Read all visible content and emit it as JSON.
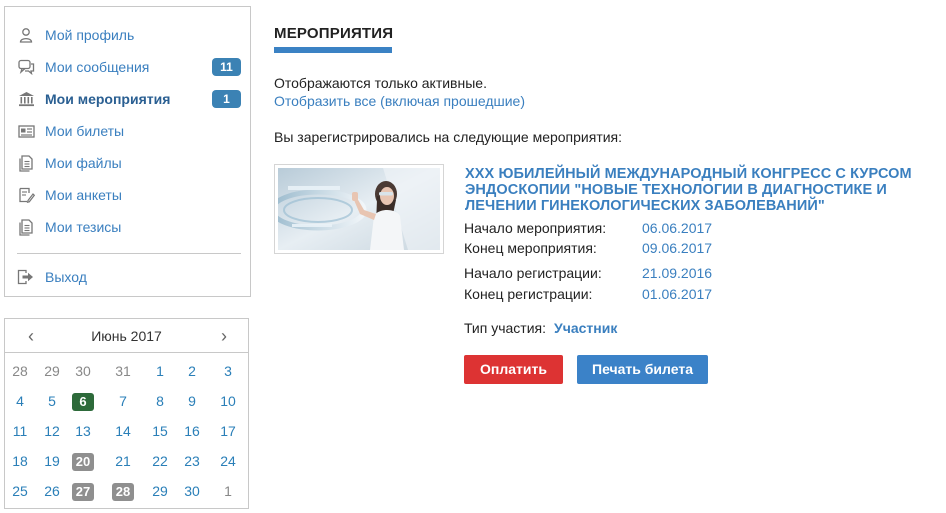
{
  "sidebar": {
    "items": [
      {
        "label": "Мой профиль",
        "icon": "user-icon"
      },
      {
        "label": "Мои сообщения",
        "icon": "chat-icon",
        "badge": "11"
      },
      {
        "label": "Мои мероприятия",
        "icon": "building-icon",
        "badge": "1",
        "active": true
      },
      {
        "label": "Мои билеты",
        "icon": "ticket-icon"
      },
      {
        "label": "Мои файлы",
        "icon": "files-icon"
      },
      {
        "label": "Мои анкеты",
        "icon": "form-edit-icon"
      },
      {
        "label": "Мои тезисы",
        "icon": "document-icon"
      }
    ],
    "logout": {
      "label": "Выход",
      "icon": "logout-icon"
    }
  },
  "calendar": {
    "title": "Июнь 2017",
    "prev": "‹",
    "next": "›",
    "weeks": [
      [
        "28",
        "29",
        "30",
        "31",
        "1",
        "2",
        "3"
      ],
      [
        "4",
        "5",
        "6",
        "7",
        "8",
        "9",
        "10"
      ],
      [
        "11",
        "12",
        "13",
        "14",
        "15",
        "16",
        "17"
      ],
      [
        "18",
        "19",
        "20",
        "21",
        "22",
        "23",
        "24"
      ],
      [
        "25",
        "26",
        "27",
        "28",
        "29",
        "30",
        "1"
      ]
    ],
    "today": "6",
    "highlighted": [
      "20",
      "27",
      "28"
    ]
  },
  "main": {
    "title": "МЕРОПРИЯТИЯ",
    "active_only_text": "Отображаются только активные.",
    "show_all_link": "Отобразить все (включая прошедшие)",
    "registered_text": "Вы зарегистрировались на следующие мероприятия:",
    "event": {
      "title": "XXX ЮБИЛЕЙНЫЙ МЕЖДУНАРОДНЫЙ КОНГРЕСС С КУРСОМ ЭНДОСКОПИИ \"НОВЫЕ ТЕХНОЛОГИИ В ДИАГНОСТИКЕ И ЛЕЧЕНИИ ГИНЕКОЛОГИЧЕСКИХ ЗАБОЛЕВАНИЙ\"",
      "start_label": "Начало мероприятия:",
      "start_value": "06.06.2017",
      "end_label": "Конец мероприятия:",
      "end_value": "09.06.2017",
      "reg_start_label": "Начало регистрации:",
      "reg_start_value": "21.09.2016",
      "reg_end_label": "Конец регистрации:",
      "reg_end_value": "01.06.2017",
      "type_label": "Тип участия:",
      "type_value": "Участник",
      "pay_button": "Оплатить",
      "print_button": "Печать билета"
    }
  },
  "colors": {
    "link": "#3a7fbf",
    "badge": "#3b82b4",
    "pay": "#dd3333",
    "print": "#3b82c8",
    "today": "#2d6a3a",
    "event_day": "#8f8f8f"
  }
}
